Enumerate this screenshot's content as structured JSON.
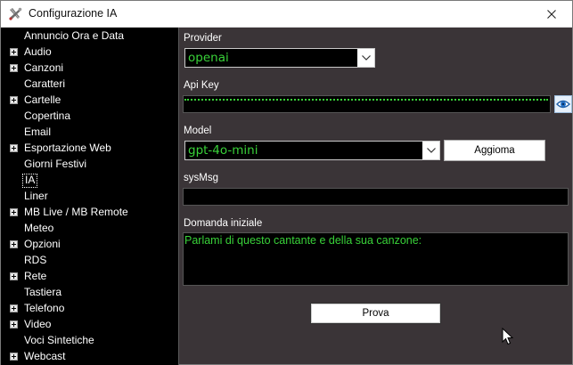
{
  "window": {
    "title": "Configurazione IA",
    "icon": "tools-icon",
    "close_symbol": "✕"
  },
  "tree": {
    "items": [
      {
        "label": "Annuncio Ora e Data",
        "expandable": false,
        "selected": false
      },
      {
        "label": "Audio",
        "expandable": true,
        "selected": false
      },
      {
        "label": "Canzoni",
        "expandable": true,
        "selected": false
      },
      {
        "label": "Caratteri",
        "expandable": false,
        "selected": false
      },
      {
        "label": "Cartelle",
        "expandable": true,
        "selected": false
      },
      {
        "label": "Copertina",
        "expandable": false,
        "selected": false
      },
      {
        "label": "Email",
        "expandable": false,
        "selected": false
      },
      {
        "label": "Esportazione Web",
        "expandable": true,
        "selected": false
      },
      {
        "label": "Giorni Festivi",
        "expandable": false,
        "selected": false
      },
      {
        "label": "IA",
        "expandable": false,
        "selected": true
      },
      {
        "label": "Liner",
        "expandable": false,
        "selected": false
      },
      {
        "label": "MB Live / MB Remote",
        "expandable": true,
        "selected": false
      },
      {
        "label": "Meteo",
        "expandable": false,
        "selected": false
      },
      {
        "label": "Opzioni",
        "expandable": true,
        "selected": false
      },
      {
        "label": "RDS",
        "expandable": false,
        "selected": false
      },
      {
        "label": "Rete",
        "expandable": true,
        "selected": false
      },
      {
        "label": "Tastiera",
        "expandable": false,
        "selected": false
      },
      {
        "label": "Telefono",
        "expandable": true,
        "selected": false
      },
      {
        "label": "Video",
        "expandable": true,
        "selected": false
      },
      {
        "label": "Voci Sintetiche",
        "expandable": false,
        "selected": false
      },
      {
        "label": "Webcast",
        "expandable": true,
        "selected": false
      }
    ]
  },
  "form": {
    "provider_label": "Provider",
    "provider_value": "openai",
    "apikey_label": "Api Key",
    "apikey_value": "",
    "model_label": "Model",
    "model_value": "gpt-4o-mini",
    "update_button": "Aggioma",
    "sysmsg_label": "sysMsg",
    "sysmsg_value": "",
    "initial_question_label": "Domanda iniziale",
    "initial_question_value": "Parlami di questo cantante e della sua canzone:",
    "test_button": "Prova"
  },
  "colors": {
    "panel_bg": "#3a3437",
    "tree_bg": "#000000",
    "field_bg": "#000000",
    "text_green": "#39d239",
    "label_white": "#ffffff"
  }
}
